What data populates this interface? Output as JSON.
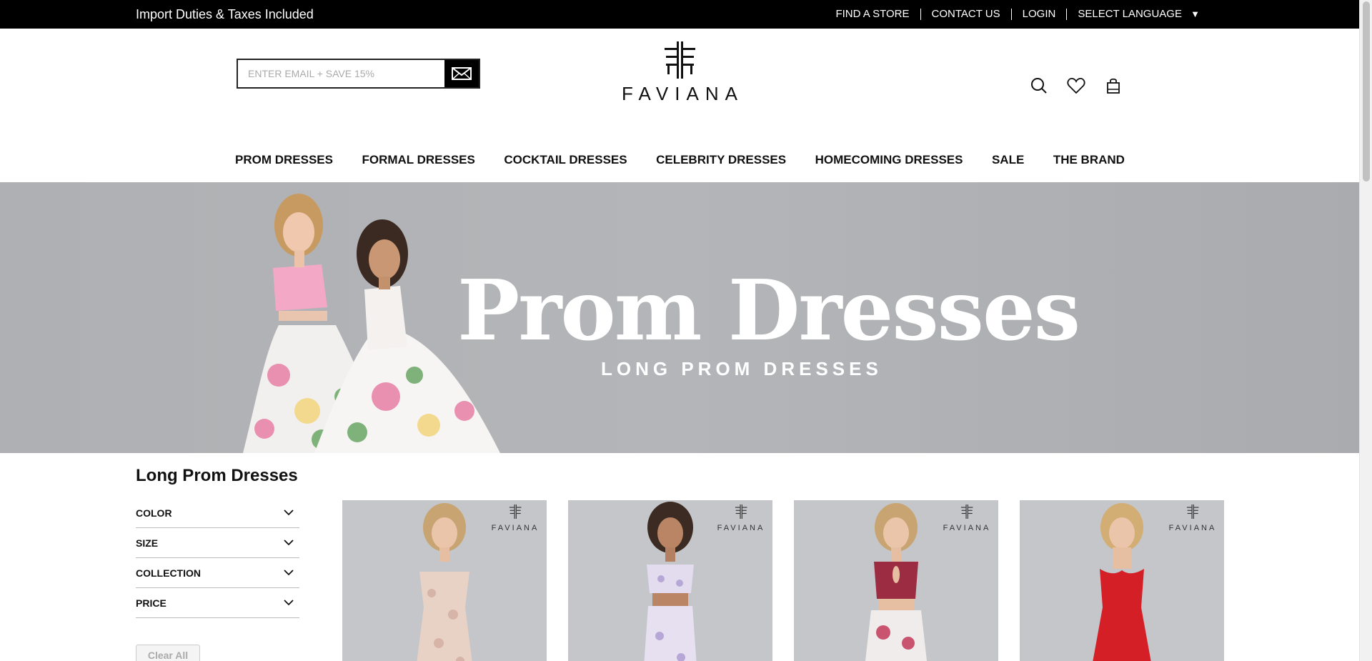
{
  "topbar": {
    "promo": "Import Duties & Taxes Included",
    "links": [
      "FIND A STORE",
      "CONTACT US",
      "LOGIN",
      "SELECT LANGUAGE"
    ],
    "caret": "▼"
  },
  "header": {
    "email_placeholder": "ENTER EMAIL + SAVE 15%",
    "logo_text": "FAVIANA",
    "icons": [
      "search-icon",
      "heart-icon",
      "bag-icon"
    ]
  },
  "nav": {
    "items": [
      "PROM DRESSES",
      "FORMAL DRESSES",
      "COCKTAIL DRESSES",
      "CELEBRITY DRESSES",
      "HOMECOMING DRESSES",
      "SALE",
      "THE BRAND"
    ]
  },
  "hero": {
    "title": "Prom Dresses",
    "subtitle": "LONG PROM DRESSES"
  },
  "listing": {
    "title": "Long Prom Dresses",
    "filters": [
      "COLOR",
      "SIZE",
      "COLLECTION",
      "PRICE"
    ],
    "clear_label": "Clear All",
    "card_brand": "FAVIANA"
  },
  "colors": {
    "topbar_bg": "#000000",
    "hero_bg": "#b1b3b6",
    "card_bg": "#c4c6c9"
  }
}
